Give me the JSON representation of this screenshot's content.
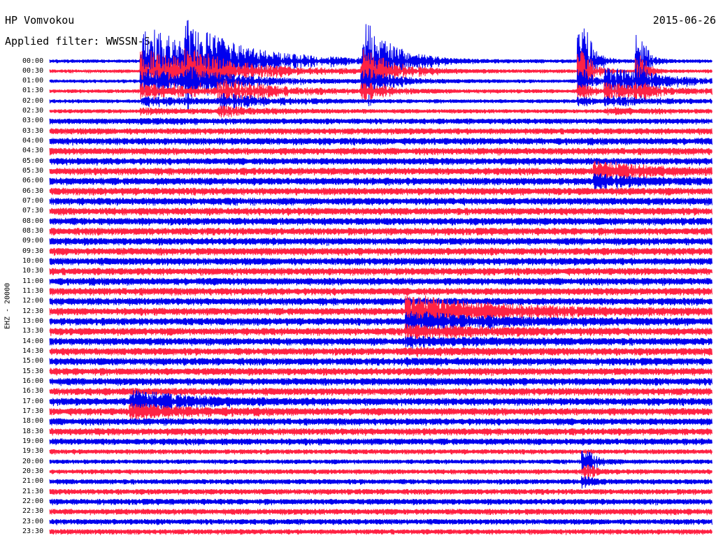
{
  "header": {
    "station": "HP Vomvokou",
    "date": "2015-06-26",
    "filter": "Applied filter: WWSSN-S"
  },
  "colors": {
    "trace_a": "#0000ee",
    "trace_b": "#ff2244",
    "background": "#ffffff"
  },
  "chart_data": {
    "type": "helicorder",
    "title": "HP Vomvokou",
    "date": "2015-06-26",
    "channel_label": "EHZ - 20000",
    "row_interval_minutes": 30,
    "row_labels": [
      "00:00",
      "00:30",
      "01:00",
      "01:30",
      "02:00",
      "02:30",
      "03:00",
      "03:30",
      "04:00",
      "04:30",
      "05:00",
      "05:30",
      "06:00",
      "06:30",
      "07:00",
      "07:30",
      "08:00",
      "08:30",
      "09:00",
      "09:30",
      "10:00",
      "10:30",
      "11:00",
      "11:30",
      "12:00",
      "12:30",
      "13:00",
      "13:30",
      "14:00",
      "14:30",
      "15:00",
      "15:30",
      "16:00",
      "16:30",
      "17:00",
      "17:30",
      "18:00",
      "18:30",
      "19:00",
      "19:30",
      "20:00",
      "20:30",
      "21:00",
      "21:30",
      "22:00",
      "22:30",
      "23:00",
      "23:30"
    ],
    "series_colors": [
      "#0000ee",
      "#ff2244"
    ],
    "noise_level_by_row": [
      0.5,
      0.5,
      0.5,
      0.55,
      0.55,
      0.6,
      0.8,
      0.9,
      1.0,
      1.0,
      1.0,
      1.05,
      1.05,
      1.05,
      1.05,
      1.05,
      1.05,
      1.05,
      1.05,
      1.05,
      1.05,
      1.05,
      1.05,
      1.05,
      1.05,
      1.05,
      1.05,
      1.05,
      1.05,
      1.05,
      1.05,
      1.05,
      1.05,
      1.05,
      1.05,
      1.05,
      1.0,
      1.0,
      0.95,
      0.7,
      0.65,
      0.7,
      0.75,
      0.8,
      0.85,
      0.85,
      0.8,
      0.75
    ],
    "events": [
      {
        "row": 0,
        "minute": 4.5,
        "amplitude": 8,
        "decay_min": 3.5,
        "spread_rows": 6
      },
      {
        "row": 0,
        "minute": 6.5,
        "amplitude": 5,
        "decay_min": 1.5,
        "spread_rows": 2
      },
      {
        "row": 0,
        "minute": 14.5,
        "amplitude": 8,
        "decay_min": 1.2,
        "spread_rows": 3
      },
      {
        "row": 0,
        "minute": 24.3,
        "amplitude": 8,
        "decay_min": 0.4,
        "spread_rows": 4
      },
      {
        "row": 0,
        "minute": 26.9,
        "amplitude": 6,
        "decay_min": 0.3,
        "spread_rows": 3
      },
      {
        "row": 2,
        "minute": 25.5,
        "amplitude": 3,
        "decay_min": 2.5,
        "spread_rows": 3
      },
      {
        "row": 3,
        "minute": 8.0,
        "amplitude": 2.5,
        "decay_min": 2.0,
        "spread_rows": 2
      },
      {
        "row": 11,
        "minute": 25.0,
        "amplitude": 2.2,
        "decay_min": 2.0,
        "spread_rows": 1
      },
      {
        "row": 25,
        "minute": 16.5,
        "amplitude": 3.5,
        "decay_min": 4.0,
        "spread_rows": 14
      },
      {
        "row": 34,
        "minute": 4.0,
        "amplitude": 2.5,
        "decay_min": 2.5,
        "spread_rows": 1
      },
      {
        "row": 40,
        "minute": 24.5,
        "amplitude": 2.5,
        "decay_min": 0.4,
        "spread_rows": 2
      }
    ]
  }
}
